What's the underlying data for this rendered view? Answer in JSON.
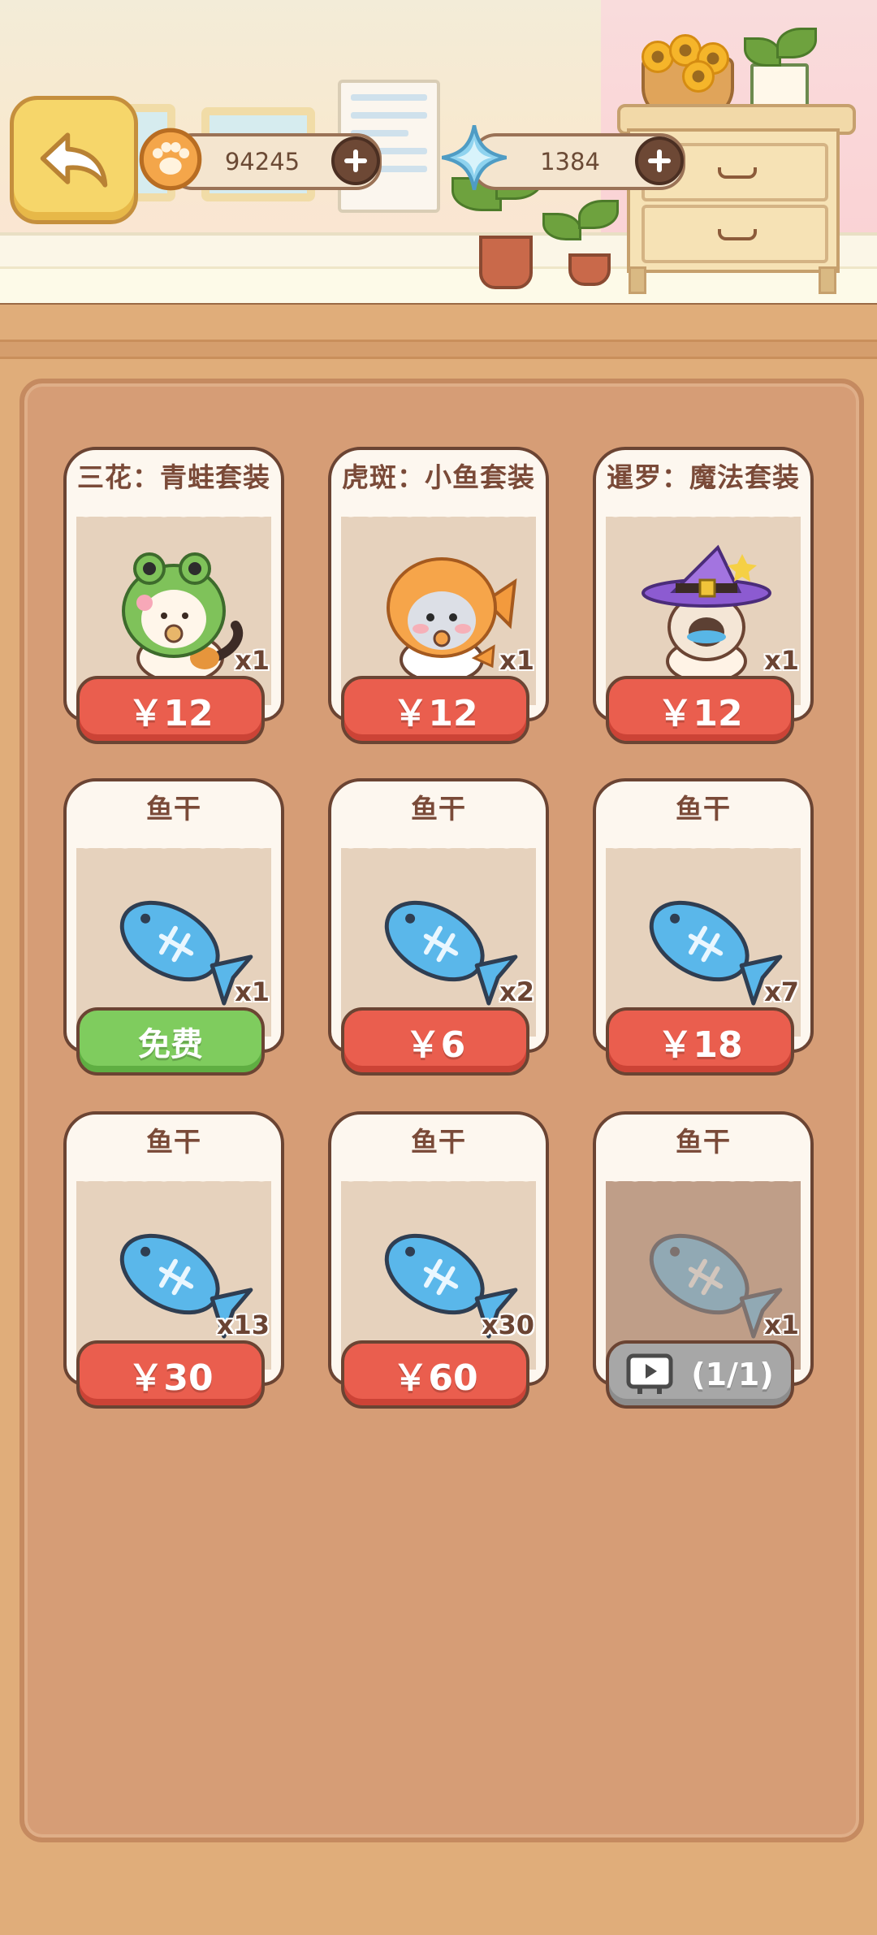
{
  "header": {
    "paw_coins": "94245",
    "gems": "1384"
  },
  "items": [
    {
      "title": "三花：青蛙套装",
      "qty": "x1",
      "price": "￥12",
      "kind": "costume-frog",
      "button": "red"
    },
    {
      "title": "虎斑：小鱼套装",
      "qty": "x1",
      "price": "￥12",
      "kind": "costume-fish",
      "button": "red"
    },
    {
      "title": "暹罗：魔法套装",
      "qty": "x1",
      "price": "￥12",
      "kind": "costume-magic",
      "button": "red"
    },
    {
      "title": "鱼干",
      "qty": "x1",
      "price": "免费",
      "kind": "dried-fish",
      "button": "green"
    },
    {
      "title": "鱼干",
      "qty": "x2",
      "price": "￥6",
      "kind": "dried-fish",
      "button": "red"
    },
    {
      "title": "鱼干",
      "qty": "x7",
      "price": "￥18",
      "kind": "dried-fish",
      "button": "red"
    },
    {
      "title": "鱼干",
      "qty": "x13",
      "price": "￥30",
      "kind": "dried-fish",
      "button": "red"
    },
    {
      "title": "鱼干",
      "qty": "x30",
      "price": "￥60",
      "kind": "dried-fish",
      "button": "red"
    },
    {
      "title": "鱼干",
      "qty": "x1",
      "price": "(1/1)",
      "kind": "dried-fish-ad",
      "button": "grey",
      "icon": "video-ad-icon"
    }
  ],
  "colors": {
    "accent_red": "#ea5e4e",
    "free_green": "#7fcc5e",
    "ad_grey": "#a7a7a7",
    "panel": "#d69d76"
  }
}
